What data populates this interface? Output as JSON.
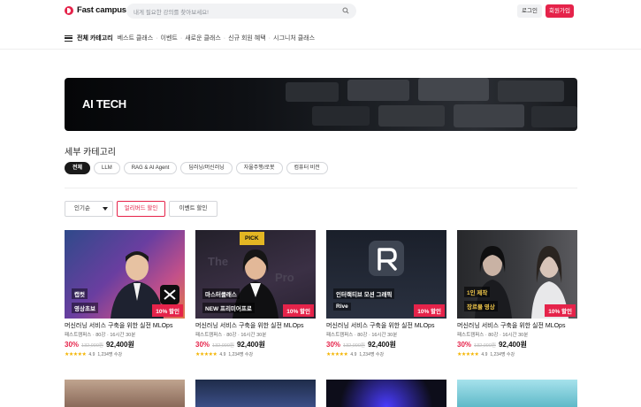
{
  "header": {
    "logo": "Fast campus",
    "search_placeholder": "내게 필요한 강의를 찾아보세요!",
    "login": "로그인",
    "signup": "회원가입"
  },
  "nav": {
    "all_categories": "전체 카테고리",
    "items": [
      "베스트 클래스",
      "이벤트",
      "새로운 클래스",
      "신규 회원 혜택",
      "시그니처 클래스"
    ]
  },
  "banner": {
    "title": "AI TECH"
  },
  "subcategory": {
    "title": "세부 카테고리",
    "chips": [
      "전체",
      "LLM",
      "RAG & AI Agent",
      "딥러닝/머신러닝",
      "자율주행/로봇",
      "컴퓨터 비전"
    ],
    "active": "전체"
  },
  "filters": {
    "sort": "인기순",
    "buttons": [
      "얼리버드 할인",
      "이벤트 할인"
    ]
  },
  "cards": [
    {
      "tag1": "캡컷",
      "tag2": "영상초보",
      "discount_badge": "10% 할인",
      "title": "머신러닝 서비스 구축을 위한 실전 MLOps",
      "meta": "패스트캠퍼스 · 80강 · 16시간 30분",
      "pct": "30%",
      "orig": "132,000원",
      "price": "92,400원",
      "rating": "4.9",
      "reviews": "1,234명 수강"
    },
    {
      "tag1": "마스터클래스",
      "tag2": "NEW 프리미어프로",
      "top_badge": "PICK",
      "discount_badge": "10% 할인",
      "title": "머신러닝 서비스 구축을 위한 실전 MLOps",
      "meta": "패스트캠퍼스 · 80강 · 16시간 30분",
      "pct": "30%",
      "orig": "132,000원",
      "price": "92,400원",
      "rating": "4.9",
      "reviews": "1,234명 수강"
    },
    {
      "tag1": "인터랙티브 모션 그래픽",
      "tag2": "Rive",
      "discount_badge": "10% 할인",
      "title": "머신러닝 서비스 구축을 위한 실전 MLOps",
      "meta": "패스트캠퍼스 · 80강 · 16시간 30분",
      "pct": "30%",
      "orig": "132,000원",
      "price": "92,400원",
      "rating": "4.9",
      "reviews": "1,234명 수강"
    },
    {
      "tag1": "1인 제작",
      "tag2": "장르물 영상",
      "discount_badge": "10% 할인",
      "title": "머신러닝 서비스 구축을 위한 실전 MLOps",
      "meta": "패스트캠퍼스 · 80강 · 16시간 30분",
      "pct": "30%",
      "orig": "132,000원",
      "price": "92,400원",
      "rating": "4.9",
      "reviews": "1,234명 수강"
    }
  ],
  "colors": {
    "accent": "#e5234a",
    "star": "#f4b400"
  }
}
